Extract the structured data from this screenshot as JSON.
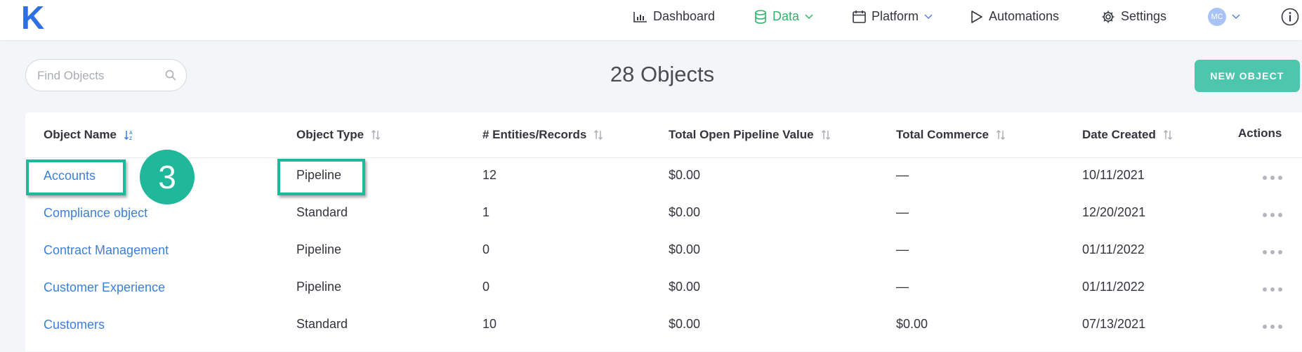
{
  "logo": "K",
  "nav": {
    "dashboard": "Dashboard",
    "data": "Data",
    "platform": "Platform",
    "automations": "Automations",
    "settings": "Settings",
    "avatar_initials": "MC"
  },
  "search": {
    "placeholder": "Find Objects",
    "value": ""
  },
  "object_count_title": "28 Objects",
  "new_object_button": "NEW OBJECT",
  "table": {
    "headers": {
      "name": "Object Name",
      "type": "Object Type",
      "entities": "# Entities/Records",
      "pipeline_value": "Total Open Pipeline Value",
      "commerce": "Total Commerce",
      "date_created": "Date Created",
      "actions": "Actions"
    },
    "rows": [
      {
        "name": "Accounts",
        "type": "Pipeline",
        "entities": "12",
        "pipeline_value": "$0.00",
        "commerce": "—",
        "date_created": "10/11/2021"
      },
      {
        "name": "Compliance object",
        "type": "Standard",
        "entities": "1",
        "pipeline_value": "$0.00",
        "commerce": "—",
        "date_created": "12/20/2021"
      },
      {
        "name": "Contract Management",
        "type": "Pipeline",
        "entities": "0",
        "pipeline_value": "$0.00",
        "commerce": "—",
        "date_created": "01/11/2022"
      },
      {
        "name": "Customer Experience",
        "type": "Pipeline",
        "entities": "0",
        "pipeline_value": "$0.00",
        "commerce": "—",
        "date_created": "01/11/2022"
      },
      {
        "name": "Customers",
        "type": "Standard",
        "entities": "10",
        "pipeline_value": "$0.00",
        "commerce": "$0.00",
        "date_created": "07/13/2021"
      }
    ]
  },
  "step_badge": "3",
  "colors": {
    "brand": "#2f6fe4",
    "active_nav": "#2fb36b",
    "primary_button": "#4cc7ae",
    "link": "#3b7fdd",
    "highlight": "#1fb89a"
  },
  "icons": [
    "bar-chart-icon",
    "database-icon",
    "calendar-icon",
    "play-icon",
    "gear-icon",
    "chevron-down-icon",
    "info-icon",
    "search-icon",
    "sort-icon",
    "more-icon"
  ]
}
